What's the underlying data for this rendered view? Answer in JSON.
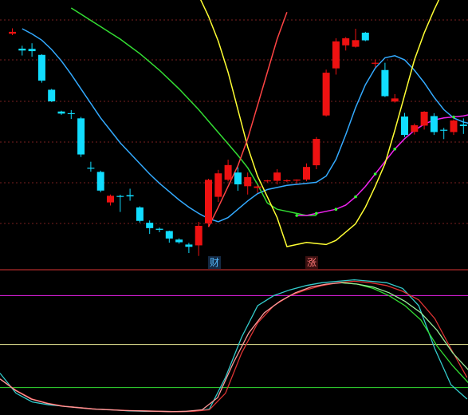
{
  "chart_data": [
    {
      "type": "candlestick",
      "panel": "price",
      "candles": [
        {
          "o": 92.6,
          "h": 95.2,
          "l": 91.9,
          "c": 93.5
        },
        {
          "o": 85.4,
          "h": 86.8,
          "l": 82.1,
          "c": 84.5
        },
        {
          "o": 85.3,
          "h": 88.0,
          "l": 81.5,
          "c": 84.2
        },
        {
          "o": 82.4,
          "h": 82.7,
          "l": 69.0,
          "c": 70.0
        },
        {
          "o": 65.6,
          "h": 66.0,
          "l": 59.7,
          "c": 60.0
        },
        {
          "o": 55.1,
          "h": 55.5,
          "l": 53.5,
          "c": 54.1
        },
        {
          "o": 54.3,
          "h": 55.8,
          "l": 51.5,
          "c": 53.9
        },
        {
          "o": 51.8,
          "h": 52.5,
          "l": 33.2,
          "c": 34.4
        },
        {
          "o": 28.0,
          "h": 30.9,
          "l": 26.1,
          "c": 27.9
        },
        {
          "o": 26.0,
          "h": 26.6,
          "l": 16.2,
          "c": 17.0
        },
        {
          "o": 11.3,
          "h": 15.1,
          "l": 9.8,
          "c": 14.5
        },
        {
          "o": 14.4,
          "h": 15.0,
          "l": 6.7,
          "c": 14.1
        },
        {
          "o": 14.8,
          "h": 17.9,
          "l": 12.1,
          "c": 14.2
        },
        {
          "o": 8.9,
          "h": 9.4,
          "l": 1.6,
          "c": 2.4
        },
        {
          "o": 1.5,
          "h": 2.6,
          "l": -3.9,
          "c": -1.1
        },
        {
          "o": -1.4,
          "h": -0.8,
          "l": -3.1,
          "c": -1.9
        },
        {
          "o": -2.5,
          "h": -2.3,
          "l": -8.1,
          "c": -6.1
        },
        {
          "o": -6.6,
          "h": -6.0,
          "l": -8.6,
          "c": -7.9
        },
        {
          "o": -9.0,
          "h": -8.2,
          "l": -13.1,
          "c": -10.1
        },
        {
          "o": -9.4,
          "h": 1.9,
          "l": -14.5,
          "c": 0.0
        },
        {
          "o": 1.2,
          "h": 22.7,
          "l": -0.2,
          "c": 22.2
        },
        {
          "o": 14.0,
          "h": 27.0,
          "l": 11.5,
          "c": 25.3
        },
        {
          "o": 22.2,
          "h": 31.9,
          "l": 21.4,
          "c": 29.3
        },
        {
          "o": 25.7,
          "h": 28.2,
          "l": 16.9,
          "c": 20.0
        },
        {
          "o": 19.1,
          "h": 25.7,
          "l": 15.1,
          "c": 23.5
        },
        {
          "o": 18.3,
          "h": 19.6,
          "l": 15.9,
          "c": 19.0
        },
        {
          "o": 21.5,
          "h": 22.2,
          "l": 20.8,
          "c": 21.9
        },
        {
          "o": 21.7,
          "h": 27.3,
          "l": 20.0,
          "c": 25.7
        },
        {
          "o": 21.5,
          "h": 22.4,
          "l": 21.1,
          "c": 22.0
        },
        {
          "o": 21.8,
          "h": 22.4,
          "l": 20.3,
          "c": 22.3
        },
        {
          "o": 22.3,
          "h": 30.1,
          "l": 21.5,
          "c": 28.4
        },
        {
          "o": 29.2,
          "h": 42.8,
          "l": 27.3,
          "c": 41.9
        },
        {
          "o": 53.2,
          "h": 75.3,
          "l": 52.7,
          "c": 73.8
        },
        {
          "o": 75.9,
          "h": 90.4,
          "l": 72.9,
          "c": 88.9
        },
        {
          "o": 87.0,
          "h": 91.0,
          "l": 84.5,
          "c": 90.4
        },
        {
          "o": 86.3,
          "h": 95.0,
          "l": 85.9,
          "c": 89.5
        },
        {
          "o": 93.1,
          "h": 93.5,
          "l": 89.0,
          "c": 89.4
        },
        {
          "o": 78.2,
          "h": 80.2,
          "l": 76.4,
          "c": 78.6
        },
        {
          "o": 75.1,
          "h": 78.6,
          "l": 62.1,
          "c": 62.5
        },
        {
          "o": 59.9,
          "h": 63.5,
          "l": 59.4,
          "c": 61.4
        },
        {
          "o": 52.7,
          "h": 54.4,
          "l": 42.8,
          "c": 43.8
        },
        {
          "o": 45.3,
          "h": 49.3,
          "l": 44.0,
          "c": 48.5
        },
        {
          "o": 48.3,
          "h": 55.3,
          "l": 46.4,
          "c": 55.0
        },
        {
          "o": 52.9,
          "h": 54.3,
          "l": 43.8,
          "c": 45.2
        },
        {
          "o": 46.3,
          "h": 47.2,
          "l": 41.8,
          "c": 45.9
        },
        {
          "o": 45.2,
          "h": 51.3,
          "l": 43.8,
          "c": 50.8
        },
        {
          "o": 48.8,
          "h": 51.8,
          "l": 44.3,
          "c": 48.1
        },
        {
          "o": 47.5,
          "h": 48.7,
          "l": 44.2,
          "c": 44.8
        }
      ],
      "lines": [
        {
          "color": "#33aaff",
          "values": [
            95.0,
            92.5,
            89.5,
            85.0,
            79.5,
            73.0,
            66.0,
            59.0,
            52.0,
            46.0,
            40.0,
            35.0,
            30.0,
            25.0,
            20.5,
            16.5,
            12.5,
            9.0,
            6.0,
            3.5,
            2.0,
            4.0,
            8.0,
            12.0,
            15.5,
            17.5,
            18.5,
            19.5,
            20.0,
            20.5,
            21.0,
            24.0,
            32.0,
            44.0,
            57.0,
            68.0,
            76.0,
            81.0,
            82.0,
            80.0,
            75.0,
            69.0,
            62.0,
            56.0,
            52.0,
            50.0,
            49.0,
            48.5
          ]
        },
        {
          "color": "#33dd33",
          "values": [
            105.0,
            102.0,
            99.0,
            96.0,
            93.0,
            90.0,
            86.5,
            83.0,
            79.0,
            75.0,
            70.5,
            66.0,
            61.0,
            56.0,
            50.5,
            45.0,
            39.5,
            34.0,
            28.0,
            20.0,
            11.0,
            8.0,
            7.0,
            6.0,
            5.0,
            5.0
          ]
        },
        {
          "color": "#ee22ee",
          "values": [
            5.0,
            5.0,
            6.0,
            7.0,
            8.0,
            10.0,
            14.0,
            19.0,
            25.0,
            31.0,
            37.0,
            42.0,
            46.0,
            49.0,
            51.0,
            52.0,
            52.5,
            53.0,
            54.0,
            55.0,
            56.0,
            57.0,
            59.0,
            61.0,
            63.0,
            65.0,
            67.0,
            68.5,
            70.0,
            71.0,
            72.0,
            73.0,
            73.5,
            74.0,
            74.0
          ]
        },
        {
          "color": "#ffff33",
          "values": [
            137.0,
            129.0,
            120.0,
            111.0,
            101.0,
            89.0,
            74.0,
            56.0,
            38.0,
            24.0,
            14.0,
            4.0,
            -10.0,
            -9.0,
            -8.0,
            -8.5,
            -9.0,
            -7.0,
            -3.0,
            1.0,
            9.0,
            19.0,
            30.0,
            46.0,
            63.0,
            80.0,
            93.0,
            104.0,
            114.0,
            125.0,
            132.0,
            136.0
          ]
        },
        {
          "color": "#ff4444",
          "values": [
            -0.5,
            9.0,
            19.0,
            29.0,
            42.0,
            58.0,
            74.0,
            90.0,
            103.0
          ]
        }
      ],
      "markers": [
        {
          "label": "财",
          "color": "#55bbff",
          "bg": "#142a44"
        },
        {
          "label": "涨",
          "color": "#ff7777",
          "bg": "#3a1010"
        }
      ]
    },
    {
      "type": "line",
      "panel": "oscillator",
      "ylim": [
        0,
        100
      ],
      "reference_levels": [
        {
          "value": 100,
          "color": "#dd3333"
        },
        {
          "value": 82,
          "color": "#ee22ee"
        },
        {
          "value": 48,
          "color": "#eeee99"
        },
        {
          "value": 18,
          "color": "#33dd33"
        }
      ],
      "series": [
        {
          "color": "#33cccc",
          "values": [
            28.0,
            14.0,
            8.0,
            6.0,
            5.0,
            4.0,
            3.0,
            2.5,
            1.8,
            1.5,
            1.5,
            1.2,
            1.5,
            3.0,
            25.0,
            53.0,
            75.0,
            82.0,
            86.0,
            89.0,
            91.0,
            92.0,
            93.0,
            92.0,
            91.0,
            87.0,
            75.0,
            45.0,
            20.0,
            10.0
          ]
        },
        {
          "color": "#dd3333",
          "values": [
            24.0,
            16.0,
            10.0,
            7.0,
            5.0,
            4.0,
            3.0,
            2.5,
            2.0,
            1.8,
            1.5,
            1.2,
            1.5,
            2.5,
            14.0,
            42.0,
            63.0,
            75.0,
            82.0,
            86.0,
            89.0,
            91.0,
            92.0,
            91.0,
            89.0,
            85.0,
            79.0,
            66.0,
            45.0,
            25.0
          ]
        },
        {
          "color": "#ff9999",
          "values": [
            24.0,
            16.0,
            10.0,
            7.0,
            5.0,
            4.0,
            3.0,
            2.5,
            2.0,
            1.8,
            1.5,
            1.2,
            1.5,
            2.5,
            11.0,
            35.0,
            56.0,
            70.0,
            78.0,
            84.0,
            88.0,
            90.0,
            91.0
          ]
        },
        {
          "color": "#33dd33",
          "values": [
            91.0,
            90.0,
            87.0,
            82.0,
            75.0,
            65.0,
            47.0,
            33.0,
            21.0
          ]
        },
        {
          "color": "#99ee99",
          "values": [
            91.0,
            90.0,
            88.0,
            84.0,
            78.0,
            70.0,
            58.0,
            42.0,
            30.0
          ]
        }
      ]
    }
  ]
}
